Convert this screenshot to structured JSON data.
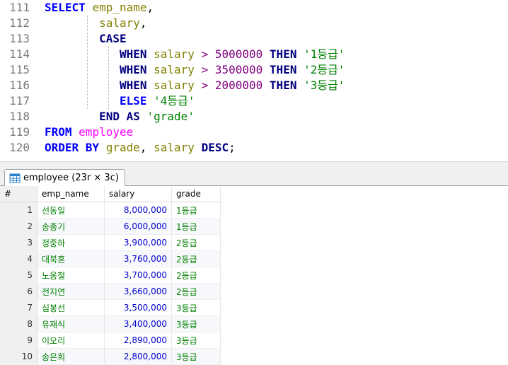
{
  "editor": {
    "line_numbers": [
      "111",
      "112",
      "113",
      "114",
      "115",
      "116",
      "117",
      "118",
      "119",
      "120"
    ],
    "lines": [
      [
        {
          "t": "SELECT",
          "c": "kw"
        },
        {
          "t": " ",
          "c": "pl"
        },
        {
          "t": "emp_name",
          "c": "id"
        },
        {
          "t": ",",
          "c": "pl"
        }
      ],
      [
        {
          "t": "        ",
          "c": "pl"
        },
        {
          "t": "salary",
          "c": "id"
        },
        {
          "t": ",",
          "c": "pl"
        }
      ],
      [
        {
          "t": "        ",
          "c": "pl"
        },
        {
          "t": "CASE",
          "c": "kw2"
        }
      ],
      [
        {
          "t": "           ",
          "c": "pl"
        },
        {
          "t": "WHEN",
          "c": "kw2"
        },
        {
          "t": " ",
          "c": "pl"
        },
        {
          "t": "salary",
          "c": "id"
        },
        {
          "t": " > ",
          "c": "op"
        },
        {
          "t": "5000000",
          "c": "num"
        },
        {
          "t": " ",
          "c": "pl"
        },
        {
          "t": "THEN",
          "c": "kw2"
        },
        {
          "t": " ",
          "c": "pl"
        },
        {
          "t": "'1등급'",
          "c": "str"
        }
      ],
      [
        {
          "t": "           ",
          "c": "pl"
        },
        {
          "t": "WHEN",
          "c": "kw2"
        },
        {
          "t": " ",
          "c": "pl"
        },
        {
          "t": "salary",
          "c": "id"
        },
        {
          "t": " > ",
          "c": "op"
        },
        {
          "t": "3500000",
          "c": "num"
        },
        {
          "t": " ",
          "c": "pl"
        },
        {
          "t": "THEN",
          "c": "kw2"
        },
        {
          "t": " ",
          "c": "pl"
        },
        {
          "t": "'2등급'",
          "c": "str"
        }
      ],
      [
        {
          "t": "           ",
          "c": "pl"
        },
        {
          "t": "WHEN",
          "c": "kw2"
        },
        {
          "t": " ",
          "c": "pl"
        },
        {
          "t": "salary",
          "c": "id"
        },
        {
          "t": " > ",
          "c": "op"
        },
        {
          "t": "2000000",
          "c": "num"
        },
        {
          "t": " ",
          "c": "pl"
        },
        {
          "t": "THEN",
          "c": "kw2"
        },
        {
          "t": " ",
          "c": "pl"
        },
        {
          "t": "'3등급'",
          "c": "str"
        }
      ],
      [
        {
          "t": "           ",
          "c": "pl"
        },
        {
          "t": "ELSE",
          "c": "kw"
        },
        {
          "t": " ",
          "c": "pl"
        },
        {
          "t": "'4등급'",
          "c": "str"
        }
      ],
      [
        {
          "t": "        ",
          "c": "pl"
        },
        {
          "t": "END",
          "c": "kw2"
        },
        {
          "t": " ",
          "c": "pl"
        },
        {
          "t": "AS",
          "c": "kw2"
        },
        {
          "t": " ",
          "c": "pl"
        },
        {
          "t": "'grade'",
          "c": "str"
        }
      ],
      [
        {
          "t": "FROM",
          "c": "kw"
        },
        {
          "t": " ",
          "c": "pl"
        },
        {
          "t": "employee",
          "c": "tbl"
        }
      ],
      [
        {
          "t": "ORDER BY",
          "c": "kw"
        },
        {
          "t": " ",
          "c": "pl"
        },
        {
          "t": "grade",
          "c": "id"
        },
        {
          "t": ", ",
          "c": "pl"
        },
        {
          "t": "salary",
          "c": "id"
        },
        {
          "t": " ",
          "c": "pl"
        },
        {
          "t": "DESC",
          "c": "kw2"
        },
        {
          "t": ";",
          "c": "pl"
        }
      ]
    ]
  },
  "results": {
    "tab_label": "employee (23r × 3c)",
    "tab_icon": "table-grid-icon",
    "columns": [
      "#",
      "emp_name",
      "salary",
      "grade"
    ],
    "rows": [
      [
        "1",
        "선동일",
        "8,000,000",
        "1등급"
      ],
      [
        "2",
        "송종기",
        "6,000,000",
        "1등급"
      ],
      [
        "3",
        "정중하",
        "3,900,000",
        "2등급"
      ],
      [
        "4",
        "대북혼",
        "3,760,000",
        "2등급"
      ],
      [
        "5",
        "노옹철",
        "3,700,000",
        "2등급"
      ],
      [
        "6",
        "전지연",
        "3,660,000",
        "2등급"
      ],
      [
        "7",
        "심봉선",
        "3,500,000",
        "3등급"
      ],
      [
        "8",
        "유재식",
        "3,400,000",
        "3등급"
      ],
      [
        "9",
        "이오리",
        "2,890,000",
        "3등급"
      ],
      [
        "10",
        "송은희",
        "2,800,000",
        "3등급"
      ]
    ]
  }
}
